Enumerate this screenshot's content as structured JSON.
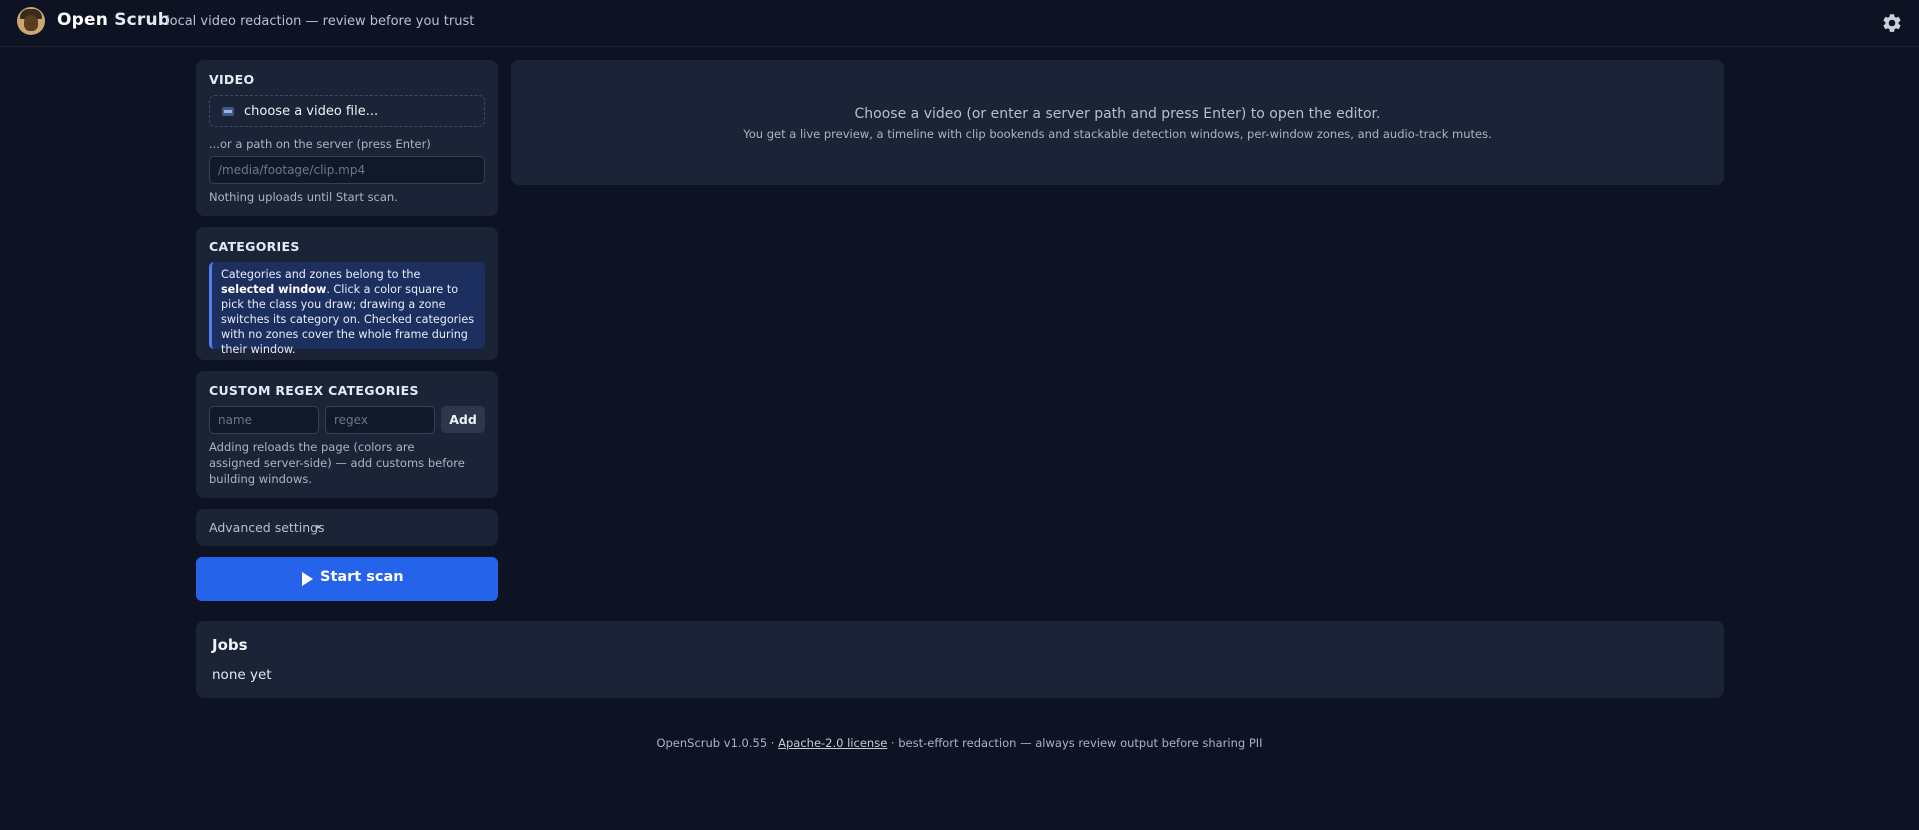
{
  "header": {
    "brand_part1": "Open",
    "brand_part2": "Scrub",
    "tagline": "local video redaction — review before you trust",
    "settings_icon": "gear-icon"
  },
  "video_panel": {
    "title": "VIDEO",
    "file_button_label": "choose a video file...",
    "file_icon": "film-icon",
    "path_hint": "...or a path on the server (press Enter)",
    "path_placeholder": "/media/footage/clip.mp4",
    "path_value": "",
    "note": "Nothing uploads until Start scan."
  },
  "categories_panel": {
    "title": "CATEGORIES",
    "info_pre": "Categories and zones belong to the ",
    "info_bold": "selected window",
    "info_post": ". Click a color square to pick the class you draw; drawing a zone switches its category on. Checked categories with no zones cover the whole frame during their window."
  },
  "custom_regex_panel": {
    "title": "CUSTOM REGEX CATEGORIES",
    "name_placeholder": "name",
    "regex_placeholder": "regex",
    "add_label": "Add",
    "note": "Adding reloads the page (colors are assigned server-side) — add customs before building windows."
  },
  "advanced": {
    "label": "Advanced settings",
    "caret": "▸"
  },
  "start_button": {
    "label": "Start scan",
    "icon": "play-icon"
  },
  "editor_placeholder": {
    "line1": "Choose a video (or enter a server path and press Enter) to open the editor.",
    "line2": "You get a live preview, a timeline with clip bookends and stackable detection windows, per-window zones, and audio-track mutes."
  },
  "jobs": {
    "title": "Jobs",
    "empty_text": "none yet"
  },
  "footer": {
    "version": "OpenScrub v1.0.55 · ",
    "license_link": "Apache-2.0 license",
    "disclaimer": " · best-effort redaction — always review output before sharing PII"
  },
  "colors": {
    "background": "#0d1322",
    "panel": "#1b2436",
    "accent": "#2563eb",
    "callout_bg": "#1d2f5e",
    "callout_border": "#4e7ef0"
  }
}
